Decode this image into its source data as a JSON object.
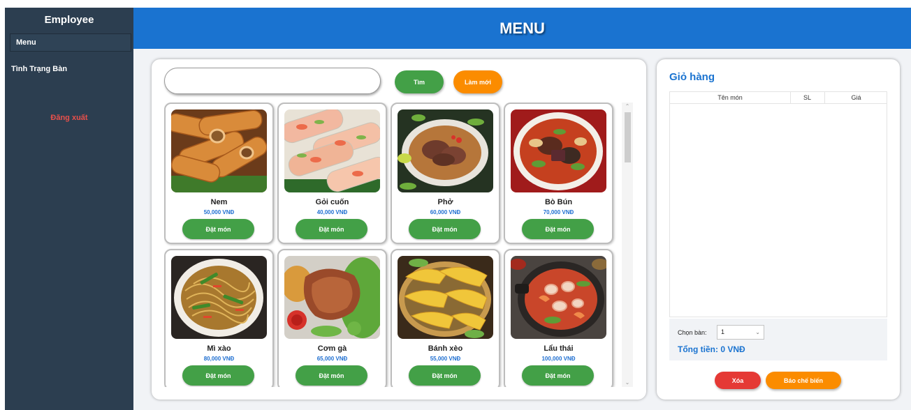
{
  "sidebar": {
    "title": "Employee",
    "items": [
      {
        "label": "Menu",
        "active": true
      },
      {
        "label": "Tình Trạng Bàn",
        "active": false
      }
    ],
    "logout": "Đăng xuất",
    "logout_color": "#e8504b"
  },
  "header": {
    "title": "MENU",
    "color": "#1a73d0"
  },
  "search": {
    "placeholder": "",
    "value": "",
    "search_label": "Tìm",
    "refresh_label": "Làm mới"
  },
  "menu_items": [
    {
      "name": "Nem",
      "price": "50,000 VNĐ",
      "button": "Đặt món",
      "image": "fried-spring-rolls-photo"
    },
    {
      "name": "Gỏi cuốn",
      "price": "40,000 VNĐ",
      "button": "Đặt món",
      "image": "fresh-spring-rolls-photo"
    },
    {
      "name": "Phở",
      "price": "60,000 VNĐ",
      "button": "Đặt món",
      "image": "pho-bowl-photo"
    },
    {
      "name": "Bò Bún",
      "price": "70,000 VNĐ",
      "button": "Đặt món",
      "image": "bun-bo-bowl-photo"
    },
    {
      "name": "Mì xào",
      "price": "80,000 VNĐ",
      "button": "Đặt món",
      "image": "stir-fried-noodles-photo"
    },
    {
      "name": "Cơm gà",
      "price": "65,000 VNĐ",
      "button": "Đặt món",
      "image": "chicken-rice-photo"
    },
    {
      "name": "Bánh xèo",
      "price": "55,000 VNĐ",
      "button": "Đặt món",
      "image": "banh-xeo-photo"
    },
    {
      "name": "Lẩu thái",
      "price": "100,000 VNĐ",
      "button": "Đặt món",
      "image": "thai-hotpot-photo"
    }
  ],
  "cart": {
    "title": "Giỏ hàng",
    "columns": [
      "Tên món",
      "SL",
      "Giá"
    ],
    "rows": [],
    "table_label": "Chọn bàn:",
    "table_value": "1",
    "total": "Tổng tiền: 0 VNĐ",
    "delete_label": "Xóa",
    "kitchen_label": "Báo chế biến"
  },
  "colors": {
    "sidebar": "#2c3e50",
    "primary": "#1a73d0",
    "green": "#43a047",
    "orange": "#fb8c00",
    "red": "#e53935"
  }
}
